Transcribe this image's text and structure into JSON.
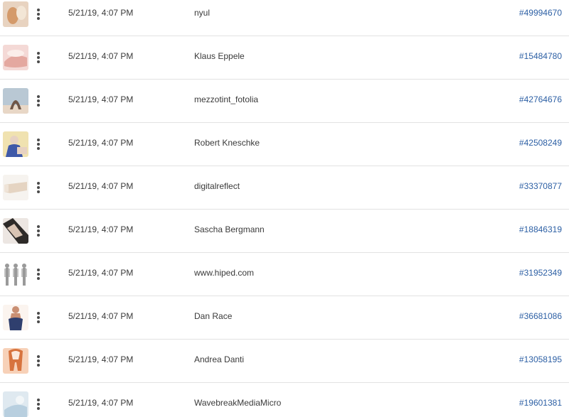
{
  "rows": [
    {
      "date": "5/21/19, 4:07 PM",
      "author": "nyul",
      "id": "#49994670",
      "thumb": {
        "icon": "photo-thumbnail-icon",
        "bg": "#e8d3c0",
        "fg": "#d49a6a",
        "accent": "#f3e6d6"
      }
    },
    {
      "date": "5/21/19, 4:07 PM",
      "author": "Klaus Eppele",
      "id": "#15484780",
      "thumb": {
        "icon": "photo-thumbnail-icon",
        "bg": "#f4d9d6",
        "fg": "#e4a8a0",
        "accent": "#fbeeea"
      }
    },
    {
      "date": "5/21/19, 4:07 PM",
      "author": "mezzotint_fotolia",
      "id": "#42764676",
      "thumb": {
        "icon": "photo-thumbnail-icon",
        "bg": "#b9c8d4",
        "fg": "#6f5648",
        "accent": "#e8d7c6"
      }
    },
    {
      "date": "5/21/19, 4:07 PM",
      "author": "Robert Kneschke",
      "id": "#42508249",
      "thumb": {
        "icon": "photo-thumbnail-icon",
        "bg": "#f0e2b0",
        "fg": "#3f59a8",
        "accent": "#e7d2c2"
      }
    },
    {
      "date": "5/21/19, 4:07 PM",
      "author": "digitalreflect",
      "id": "#33370877",
      "thumb": {
        "icon": "photo-thumbnail-icon",
        "bg": "#f6f3ef",
        "fg": "#e5d4c2",
        "accent": "#efe4d8"
      }
    },
    {
      "date": "5/21/19, 4:07 PM",
      "author": "Sascha Bergmann",
      "id": "#18846319",
      "thumb": {
        "icon": "photo-thumbnail-icon",
        "bg": "#ece6e2",
        "fg": "#2d2a28",
        "accent": "#d9c4b4"
      }
    },
    {
      "date": "5/21/19, 4:07 PM",
      "author": "www.hiped.com",
      "id": "#31952349",
      "thumb": {
        "icon": "photo-thumbnail-icon",
        "bg": "#ffffff",
        "fg": "#9a9a9a",
        "accent": "#c4c4c4"
      }
    },
    {
      "date": "5/21/19, 4:07 PM",
      "author": "Dan Race",
      "id": "#36681086",
      "thumb": {
        "icon": "photo-thumbnail-icon",
        "bg": "#fbf4ef",
        "fg": "#2f3f6e",
        "accent": "#c98f73"
      }
    },
    {
      "date": "5/21/19, 4:07 PM",
      "author": "Andrea Danti",
      "id": "#13058195",
      "thumb": {
        "icon": "photo-thumbnail-icon",
        "bg": "#f7d1b8",
        "fg": "#d7733e",
        "accent": "#fbe9dc"
      }
    },
    {
      "date": "5/21/19, 4:07 PM",
      "author": "WavebreakMediaMicro",
      "id": "#19601381",
      "thumb": {
        "icon": "photo-thumbnail-icon",
        "bg": "#dfe9f0",
        "fg": "#b8cfdf",
        "accent": "#f2f6f8"
      }
    }
  ],
  "colors": {
    "text": "#3a3a3a",
    "link": "#2c5fa4",
    "divider": "#e2e2e2",
    "more_icon": "#4b4b4b"
  },
  "icons": {
    "row_actions": "more-vertical-icon"
  }
}
